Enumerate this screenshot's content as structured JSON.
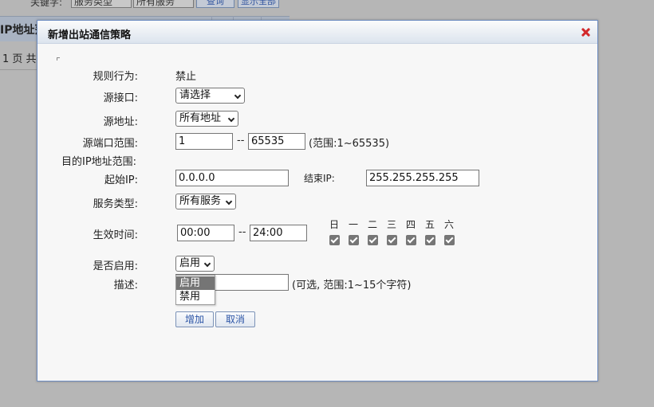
{
  "background": {
    "keyword_label": "关键字:",
    "filter_type": "服务类型",
    "filter_value": "所有服务",
    "query_button": "查询",
    "show_all_button": "显示全部",
    "table_header": "IP地址范",
    "pager": "1 页 共"
  },
  "dialog": {
    "title": "新增出站通信策略",
    "rule_action_label": "规则行为:",
    "rule_action_value": "禁止",
    "src_interface_label": "源接口:",
    "src_interface_value": "请选择",
    "src_address_label": "源地址:",
    "src_address_value": "所有地址",
    "src_port_label": "源端口范围:",
    "src_port_start": "1",
    "port_separator": "--",
    "src_port_end": "65535",
    "src_port_hint": "(范围:1~65535)",
    "dst_ip_range_label": "目的IP地址范围:",
    "start_ip_label": "起始IP:",
    "start_ip_value": "0.0.0.0",
    "end_ip_label": "结束IP:",
    "end_ip_value": "255.255.255.255",
    "service_type_label": "服务类型:",
    "service_type_value": "所有服务",
    "effective_time_label": "生效时间:",
    "time_start": "00:00",
    "time_separator": "--",
    "time_end": "24:00",
    "weekdays": [
      "日",
      "一",
      "二",
      "三",
      "四",
      "五",
      "六"
    ],
    "weekdays_checked": [
      true,
      true,
      true,
      true,
      true,
      true,
      true
    ],
    "enabled_label": "是否启用:",
    "enabled_value": "启用",
    "enabled_options": [
      "启用",
      "禁用"
    ],
    "description_label": "描述:",
    "description_value": "",
    "description_hint": "(可选, 范围:1~15个字符)",
    "add_button": "增加",
    "cancel_button": "取消"
  },
  "colors": {
    "dialog_border": "#6d8cc1",
    "close_icon": "#d2282a",
    "button_text": "#2c55a6",
    "dropdown_selected": "#757575"
  }
}
